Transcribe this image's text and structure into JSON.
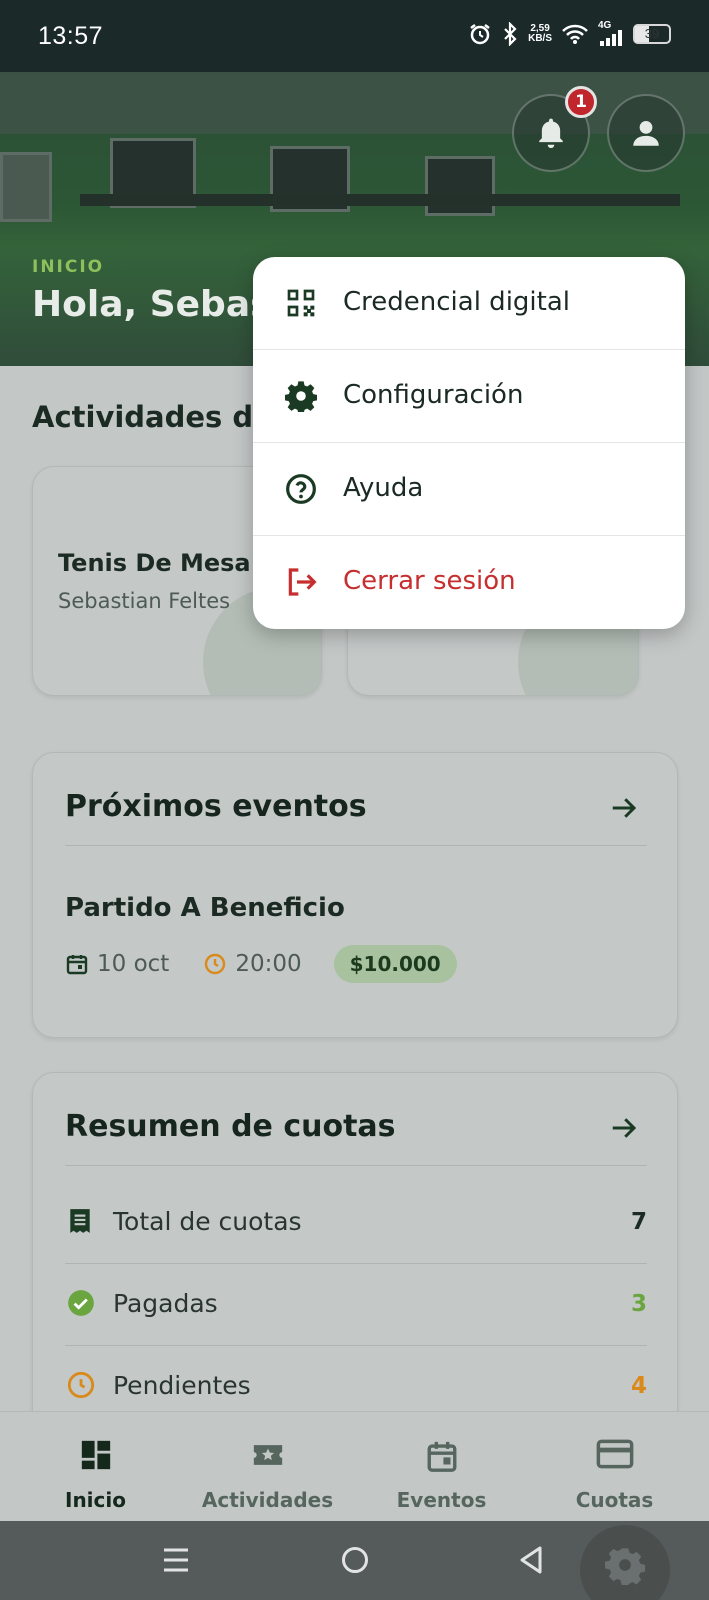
{
  "status_bar": {
    "time": "13:57",
    "net_speed_value": "2,59",
    "net_speed_unit": "KB/S",
    "network": "4G",
    "battery": "39",
    "icons": [
      "alarm-icon",
      "bluetooth-icon",
      "wifi-icon",
      "signal-icon",
      "battery-icon"
    ]
  },
  "header": {
    "section_label": "INICIO",
    "greeting": "Hola, Sebas",
    "notification_count": "1",
    "icons": [
      "bell-icon",
      "user-icon"
    ]
  },
  "activities": {
    "title": "Actividades d",
    "items": [
      {
        "name": "Tenis De Mesa",
        "member": "Sebastian Feltes"
      }
    ]
  },
  "events_card": {
    "title": "Próximos eventos",
    "event": {
      "name": "Partido A Beneficio",
      "date": "10 oct",
      "time": "20:00",
      "price": "$10.000"
    }
  },
  "fees_card": {
    "title": "Resumen de cuotas",
    "rows": [
      {
        "label": "Total de cuotas",
        "value": "7",
        "icon": "receipt-icon",
        "color": "#1b2a23"
      },
      {
        "label": "Pagadas",
        "value": "3",
        "icon": "check-circle-icon",
        "color": "#6aa53f"
      },
      {
        "label": "Pendientes",
        "value": "4",
        "icon": "clock-icon",
        "color": "#d98a1a"
      }
    ]
  },
  "bottom_nav": {
    "items": [
      {
        "label": "Inicio",
        "icon": "dashboard-icon",
        "active": true
      },
      {
        "label": "Actividades",
        "icon": "ticket-star-icon",
        "active": false
      },
      {
        "label": "Eventos",
        "icon": "calendar-icon",
        "active": false
      },
      {
        "label": "Cuotas",
        "icon": "credit-card-icon",
        "active": false
      }
    ]
  },
  "menu": {
    "items": [
      {
        "label": "Credencial digital",
        "icon": "qr-code-icon",
        "color": "#1c2a25"
      },
      {
        "label": "Configuración",
        "icon": "gear-icon",
        "color": "#1c2a25"
      },
      {
        "label": "Ayuda",
        "icon": "help-circle-icon",
        "color": "#1c2a25"
      },
      {
        "label": "Cerrar sesión",
        "icon": "logout-icon",
        "color": "#c62f2f"
      }
    ]
  },
  "colors": {
    "accent_green": "#1f4a2a",
    "label_green": "#8fbf5c",
    "danger_red": "#c62f2f",
    "badge_red": "#c0262b"
  }
}
